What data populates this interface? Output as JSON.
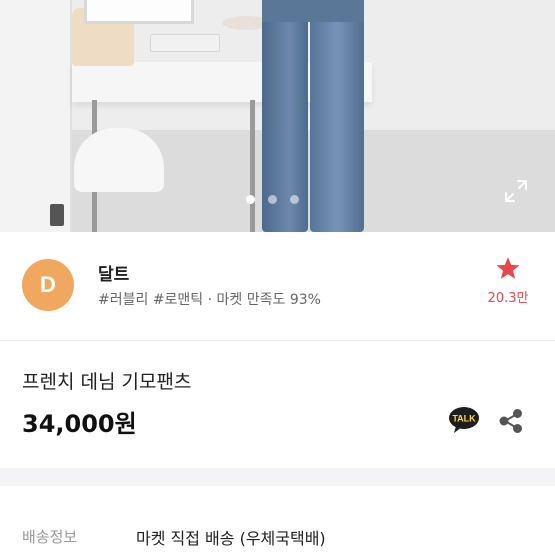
{
  "gallery": {
    "slide_count": 3,
    "active_slide": 1,
    "expand_icon": "expand-icon"
  },
  "seller": {
    "logo_letter": "D",
    "name": "달트",
    "tags": "#러블리 #로맨틱 · 마켓 만족도 93%",
    "favorite_icon": "star-icon",
    "favorite_count": "20.3만",
    "accent_color": "#e8484b",
    "logo_color": "#f0a860"
  },
  "product": {
    "name": "프렌치 데님 기모팬츠",
    "price": "34,000원",
    "talk_label": "TALK",
    "talk_icon": "kakao-talk-icon",
    "share_icon": "share-icon"
  },
  "shipping": {
    "label": "배송정보",
    "value": "마켓 직접 배송 (우체국택배)"
  }
}
